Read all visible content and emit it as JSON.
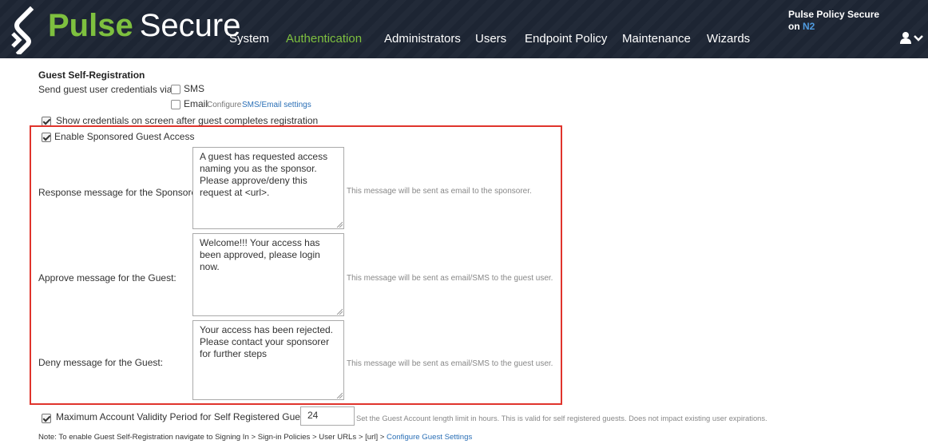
{
  "header": {
    "logo_brand": "Pulse",
    "logo_secure": "Secure",
    "product_name": "Pulse Policy Secure",
    "product_on": "on",
    "node": "N2",
    "nav": [
      {
        "label": "System"
      },
      {
        "label": "Authentication",
        "active": true
      },
      {
        "label": "Administrators"
      },
      {
        "label": "Users"
      },
      {
        "label": "Endpoint Policy"
      },
      {
        "label": "Maintenance"
      },
      {
        "label": "Wizards"
      }
    ],
    "user_icon": "user-icon",
    "colors": {
      "bar": "#1d2533",
      "brand_green": "#7ec03f",
      "node_blue": "#4f9be0"
    }
  },
  "guest": {
    "title": "Guest Self-Registration",
    "send_label": "Send guest user credentials via:",
    "sms_label": "SMS",
    "sms_checked": false,
    "email_label": "Email",
    "email_checked": false,
    "configure_prefix": "Configure",
    "configure_link": "SMS/Email settings",
    "show_credentials_label": "Show credentials on screen after guest completes registration",
    "show_credentials_checked": true
  },
  "sponsored": {
    "enable_label": "Enable Sponsored Guest Access",
    "enable_checked": true,
    "highlight_color": "#e0342c",
    "rows": [
      {
        "label": "Response message for the Sponsorer:",
        "message": "A guest has requested access naming you as the sponsor. Please approve/deny this request at <url>.",
        "hint": "This message will be sent as email to the sponsorer."
      },
      {
        "label": "Approve message for the Guest:",
        "message": "Welcome!!! Your access has been approved, please login now.",
        "hint": "This message will be sent as email/SMS to the guest user."
      },
      {
        "label": "Deny message for the Guest:",
        "message": "Your access has been rejected. Please contact your sponsorer for further steps",
        "hint": "This message will be sent as email/SMS to the guest user."
      }
    ]
  },
  "validity": {
    "label": "Maximum Account Validity Period for Self Registered Guests:",
    "checked": true,
    "value": "24",
    "hint": "Set the Guest Account length limit in hours. This is valid for self registered guests. Does not impact existing user expirations."
  },
  "note": {
    "text": "Note: To enable Guest Self-Registration navigate to Signing In > Sign-in Policies > User URLs > [url] >",
    "link": "Configure Guest Settings"
  }
}
